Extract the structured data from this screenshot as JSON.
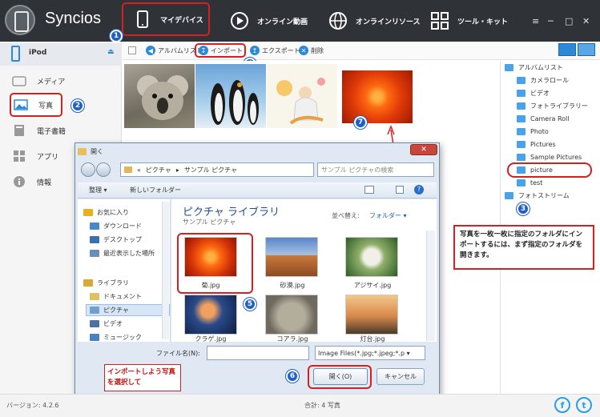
{
  "app": {
    "brand": "Syncios"
  },
  "nav": {
    "tabs": [
      {
        "label": "マイデバイス",
        "icon": "phone-icon",
        "selected": true
      },
      {
        "label": "オンライン動画",
        "icon": "play-icon"
      },
      {
        "label": "オンラインリソース",
        "icon": "globe-icon"
      },
      {
        "label": "ツール・キット",
        "icon": "grid-icon"
      }
    ],
    "window_buttons": [
      "≡",
      "─",
      "□",
      "✕"
    ]
  },
  "sidebar": {
    "device": "iPod",
    "items": [
      {
        "label": "メディア",
        "icon": "tv-icon"
      },
      {
        "label": "写真",
        "icon": "photo-icon",
        "selected": true
      },
      {
        "label": "電子書籍",
        "icon": "book-icon"
      },
      {
        "label": "アプリ",
        "icon": "apps-icon"
      },
      {
        "label": "情報",
        "icon": "info-icon"
      }
    ]
  },
  "toolbar": {
    "album_list": "アルバムリスト",
    "import": "インポート",
    "export": "エクスポート",
    "delete": "削除"
  },
  "right_panel": {
    "album_header": "アルバムリスト",
    "albums": [
      "カメラロール",
      "ビデオ",
      "フォトライブラリー",
      "Camera Roll",
      "Photo",
      "Pictures",
      "Sample Pictures",
      "picture",
      "test"
    ],
    "selected_album": "picture",
    "photo_stream": "フォトストリーム"
  },
  "callout": "写真を一枚一枚に指定のフォルダにインポートするには、まず指定のフォルダを開きます。",
  "note": "インポートしよう写真を選択して",
  "markers": [
    "1",
    "2",
    "3",
    "4",
    "5",
    "6",
    "7"
  ],
  "dialog": {
    "title": "開く",
    "address": [
      "«",
      "ピクチャ",
      "▸",
      "サンプル ピクチャ"
    ],
    "search_placeholder": "サンプル ピクチャの検索",
    "organize": "整理 ▾",
    "new_folder": "新しいフォルダー",
    "library_title": "ピクチャ ライブラリ",
    "library_sub": "サンプル ピクチャ",
    "sort_label": "並べ替え:",
    "sort_value": "フォルダー ▾",
    "nav_items": [
      {
        "label": "お気に入り",
        "color": "#e8b020"
      },
      {
        "label": "ダウンロード",
        "color": "#4a86c8"
      },
      {
        "label": "デスクトップ",
        "color": "#3a6fb0"
      },
      {
        "label": "最近表示した場所",
        "color": "#6a8fb8"
      },
      {
        "label": "ライブラリ",
        "color": "#d8a83a"
      },
      {
        "label": "ドキュメント",
        "color": "#e0c060"
      },
      {
        "label": "ピクチャ",
        "color": "#70a0d0"
      },
      {
        "label": "ビデオ",
        "color": "#5070a0"
      },
      {
        "label": "ミュージック",
        "color": "#4a80c0"
      }
    ],
    "files": [
      {
        "name": "菊.jpg",
        "color": "#e05010"
      },
      {
        "name": "砂漠.jpg",
        "color": "#b85a28"
      },
      {
        "name": "アジサイ.jpg",
        "color": "#4a7a3a"
      },
      {
        "name": "クラゲ.jpg",
        "color": "#203a6a"
      },
      {
        "name": "コアラ.jpg",
        "color": "#8a8a80"
      },
      {
        "name": "灯台.jpg",
        "color": "#7a9ac0"
      }
    ],
    "filename_label": "ファイル名(N):",
    "filetype": "Image Files(*.jpg;*.jpeg;*.p ▾",
    "open": "開く(O)",
    "cancel": "キャンセル"
  },
  "status": {
    "version": "バージョン: 4.2.6",
    "total": "合計: 4 写真"
  },
  "social": [
    "f",
    "t"
  ]
}
